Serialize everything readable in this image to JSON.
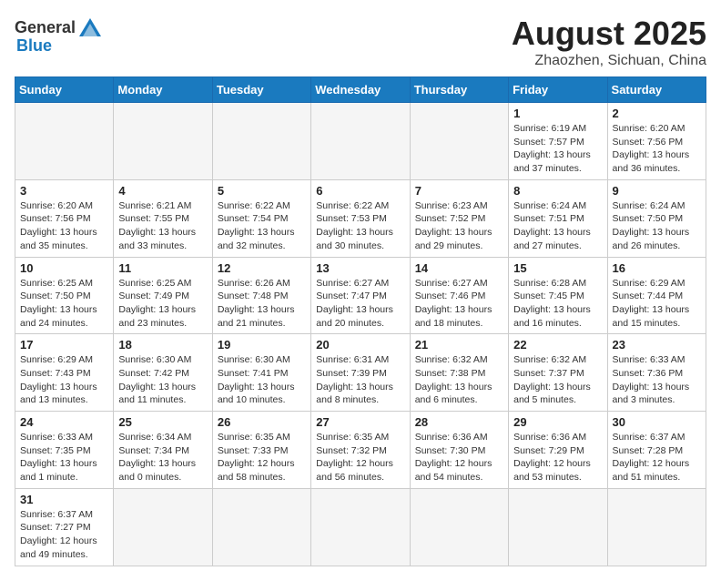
{
  "header": {
    "logo_general": "General",
    "logo_blue": "Blue",
    "title": "August 2025",
    "subtitle": "Zhaozhen, Sichuan, China"
  },
  "days_of_week": [
    "Sunday",
    "Monday",
    "Tuesday",
    "Wednesday",
    "Thursday",
    "Friday",
    "Saturday"
  ],
  "weeks": [
    [
      {
        "day": "",
        "info": ""
      },
      {
        "day": "",
        "info": ""
      },
      {
        "day": "",
        "info": ""
      },
      {
        "day": "",
        "info": ""
      },
      {
        "day": "",
        "info": ""
      },
      {
        "day": "1",
        "info": "Sunrise: 6:19 AM\nSunset: 7:57 PM\nDaylight: 13 hours\nand 37 minutes."
      },
      {
        "day": "2",
        "info": "Sunrise: 6:20 AM\nSunset: 7:56 PM\nDaylight: 13 hours\nand 36 minutes."
      }
    ],
    [
      {
        "day": "3",
        "info": "Sunrise: 6:20 AM\nSunset: 7:56 PM\nDaylight: 13 hours\nand 35 minutes."
      },
      {
        "day": "4",
        "info": "Sunrise: 6:21 AM\nSunset: 7:55 PM\nDaylight: 13 hours\nand 33 minutes."
      },
      {
        "day": "5",
        "info": "Sunrise: 6:22 AM\nSunset: 7:54 PM\nDaylight: 13 hours\nand 32 minutes."
      },
      {
        "day": "6",
        "info": "Sunrise: 6:22 AM\nSunset: 7:53 PM\nDaylight: 13 hours\nand 30 minutes."
      },
      {
        "day": "7",
        "info": "Sunrise: 6:23 AM\nSunset: 7:52 PM\nDaylight: 13 hours\nand 29 minutes."
      },
      {
        "day": "8",
        "info": "Sunrise: 6:24 AM\nSunset: 7:51 PM\nDaylight: 13 hours\nand 27 minutes."
      },
      {
        "day": "9",
        "info": "Sunrise: 6:24 AM\nSunset: 7:50 PM\nDaylight: 13 hours\nand 26 minutes."
      }
    ],
    [
      {
        "day": "10",
        "info": "Sunrise: 6:25 AM\nSunset: 7:50 PM\nDaylight: 13 hours\nand 24 minutes."
      },
      {
        "day": "11",
        "info": "Sunrise: 6:25 AM\nSunset: 7:49 PM\nDaylight: 13 hours\nand 23 minutes."
      },
      {
        "day": "12",
        "info": "Sunrise: 6:26 AM\nSunset: 7:48 PM\nDaylight: 13 hours\nand 21 minutes."
      },
      {
        "day": "13",
        "info": "Sunrise: 6:27 AM\nSunset: 7:47 PM\nDaylight: 13 hours\nand 20 minutes."
      },
      {
        "day": "14",
        "info": "Sunrise: 6:27 AM\nSunset: 7:46 PM\nDaylight: 13 hours\nand 18 minutes."
      },
      {
        "day": "15",
        "info": "Sunrise: 6:28 AM\nSunset: 7:45 PM\nDaylight: 13 hours\nand 16 minutes."
      },
      {
        "day": "16",
        "info": "Sunrise: 6:29 AM\nSunset: 7:44 PM\nDaylight: 13 hours\nand 15 minutes."
      }
    ],
    [
      {
        "day": "17",
        "info": "Sunrise: 6:29 AM\nSunset: 7:43 PM\nDaylight: 13 hours\nand 13 minutes."
      },
      {
        "day": "18",
        "info": "Sunrise: 6:30 AM\nSunset: 7:42 PM\nDaylight: 13 hours\nand 11 minutes."
      },
      {
        "day": "19",
        "info": "Sunrise: 6:30 AM\nSunset: 7:41 PM\nDaylight: 13 hours\nand 10 minutes."
      },
      {
        "day": "20",
        "info": "Sunrise: 6:31 AM\nSunset: 7:39 PM\nDaylight: 13 hours\nand 8 minutes."
      },
      {
        "day": "21",
        "info": "Sunrise: 6:32 AM\nSunset: 7:38 PM\nDaylight: 13 hours\nand 6 minutes."
      },
      {
        "day": "22",
        "info": "Sunrise: 6:32 AM\nSunset: 7:37 PM\nDaylight: 13 hours\nand 5 minutes."
      },
      {
        "day": "23",
        "info": "Sunrise: 6:33 AM\nSunset: 7:36 PM\nDaylight: 13 hours\nand 3 minutes."
      }
    ],
    [
      {
        "day": "24",
        "info": "Sunrise: 6:33 AM\nSunset: 7:35 PM\nDaylight: 13 hours\nand 1 minute."
      },
      {
        "day": "25",
        "info": "Sunrise: 6:34 AM\nSunset: 7:34 PM\nDaylight: 13 hours\nand 0 minutes."
      },
      {
        "day": "26",
        "info": "Sunrise: 6:35 AM\nSunset: 7:33 PM\nDaylight: 12 hours\nand 58 minutes."
      },
      {
        "day": "27",
        "info": "Sunrise: 6:35 AM\nSunset: 7:32 PM\nDaylight: 12 hours\nand 56 minutes."
      },
      {
        "day": "28",
        "info": "Sunrise: 6:36 AM\nSunset: 7:30 PM\nDaylight: 12 hours\nand 54 minutes."
      },
      {
        "day": "29",
        "info": "Sunrise: 6:36 AM\nSunset: 7:29 PM\nDaylight: 12 hours\nand 53 minutes."
      },
      {
        "day": "30",
        "info": "Sunrise: 6:37 AM\nSunset: 7:28 PM\nDaylight: 12 hours\nand 51 minutes."
      }
    ],
    [
      {
        "day": "31",
        "info": "Sunrise: 6:37 AM\nSunset: 7:27 PM\nDaylight: 12 hours\nand 49 minutes."
      },
      {
        "day": "",
        "info": ""
      },
      {
        "day": "",
        "info": ""
      },
      {
        "day": "",
        "info": ""
      },
      {
        "day": "",
        "info": ""
      },
      {
        "day": "",
        "info": ""
      },
      {
        "day": "",
        "info": ""
      }
    ]
  ]
}
